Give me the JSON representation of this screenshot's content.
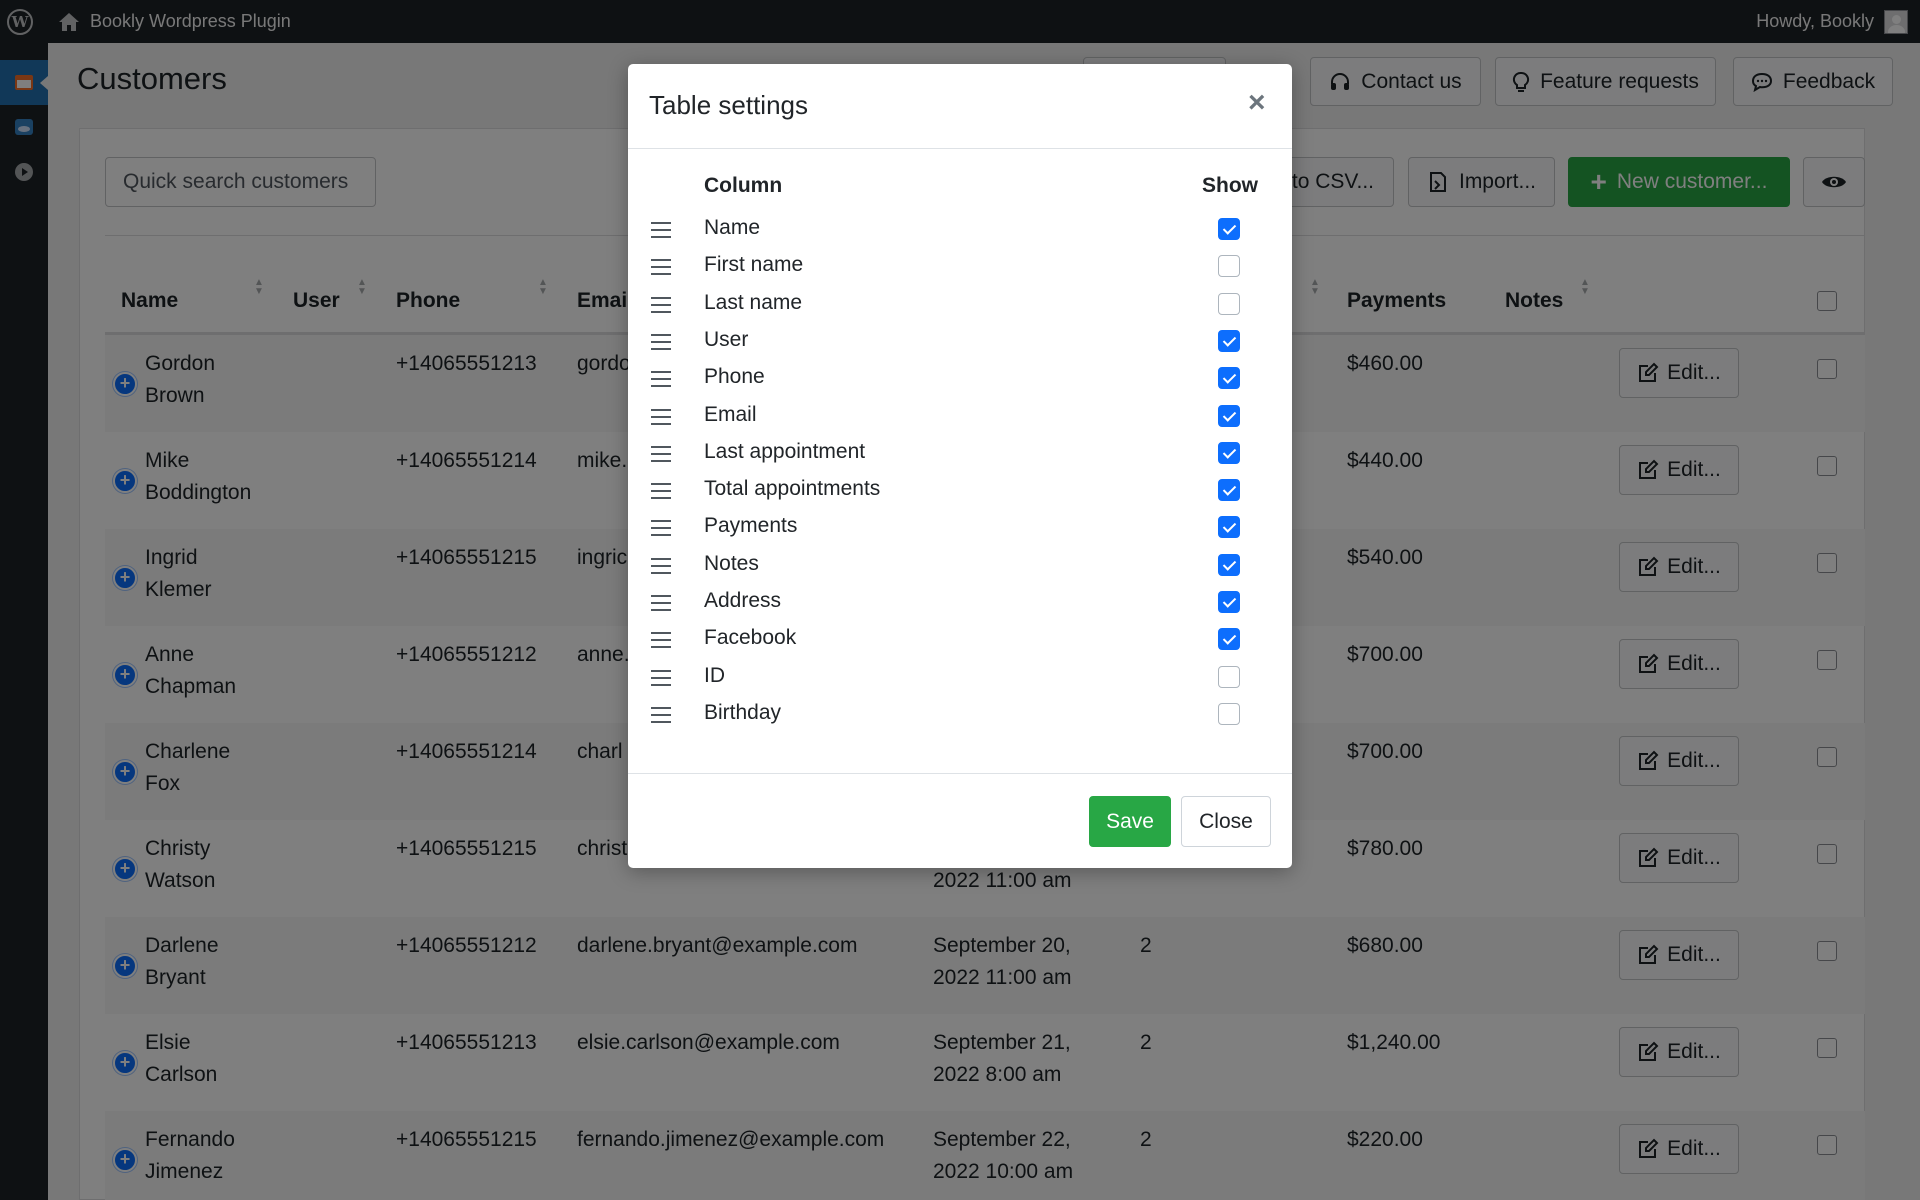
{
  "adminbar": {
    "site_name": "Bookly Wordpress Plugin",
    "howdy": "Howdy, Bookly",
    "wp_logo": "W"
  },
  "page": {
    "title": "Customers"
  },
  "top_buttons": {
    "contact": "Contact us",
    "features": "Feature requests",
    "feedback": "Feedback"
  },
  "toolbar": {
    "search_placeholder": "Quick search customers",
    "export": "to CSV...",
    "import": "Import...",
    "new_customer": "New customer..."
  },
  "table": {
    "columns": [
      "Name",
      "User",
      "Phone",
      "Emai",
      "Payments",
      "Notes"
    ],
    "rows": [
      {
        "first": "Gordon",
        "last": "Brown",
        "phone": "+14065551213",
        "email": "gordo",
        "date1": "",
        "date2": "",
        "total": "",
        "payment": "$460.00",
        "edit": "Edit..."
      },
      {
        "first": "Mike",
        "last": "Boddington",
        "phone": "+14065551214",
        "email": "mike.",
        "date1": "",
        "date2": "",
        "total": "",
        "payment": "$440.00",
        "edit": "Edit..."
      },
      {
        "first": "Ingrid",
        "last": "Klemer",
        "phone": "+14065551215",
        "email": "ingric",
        "date1": "",
        "date2": "",
        "total": "",
        "payment": "$540.00",
        "edit": "Edit..."
      },
      {
        "first": "Anne",
        "last": "Chapman",
        "phone": "+14065551212",
        "email": "anne.",
        "date1": "",
        "date2": "",
        "total": "",
        "payment": "$700.00",
        "edit": "Edit..."
      },
      {
        "first": "Charlene",
        "last": "Fox",
        "phone": "+14065551214",
        "email": "charl",
        "date1": "",
        "date2": "",
        "total": "",
        "payment": "$700.00",
        "edit": "Edit..."
      },
      {
        "first": "Christy",
        "last": "Watson",
        "phone": "+14065551215",
        "email": "christ",
        "date1": "",
        "date2": "2022 11:00 am",
        "total": "",
        "payment": "$780.00",
        "edit": "Edit..."
      },
      {
        "first": "Darlene",
        "last": "Bryant",
        "phone": "+14065551212",
        "email": "darlene.bryant@example.com",
        "date1": "September 20,",
        "date2": "2022 11:00 am",
        "total": "2",
        "payment": "$680.00",
        "edit": "Edit..."
      },
      {
        "first": "Elsie",
        "last": "Carlson",
        "phone": "+14065551213",
        "email": "elsie.carlson@example.com",
        "date1": "September 21,",
        "date2": "2022 8:00 am",
        "total": "2",
        "payment": "$1,240.00",
        "edit": "Edit..."
      },
      {
        "first": "Fernando",
        "last": "Jimenez",
        "phone": "+14065551215",
        "email": "fernando.jimenez@example.com",
        "date1": "September 22,",
        "date2": "2022 10:00 am",
        "total": "2",
        "payment": "$220.00",
        "edit": "Edit..."
      }
    ]
  },
  "modal": {
    "title": "Table settings",
    "close_glyph": "×",
    "column_header": "Column",
    "show_header": "Show",
    "settings": [
      {
        "label": "Name",
        "show": true
      },
      {
        "label": "First name",
        "show": false
      },
      {
        "label": "Last name",
        "show": false
      },
      {
        "label": "User",
        "show": true
      },
      {
        "label": "Phone",
        "show": true
      },
      {
        "label": "Email",
        "show": true
      },
      {
        "label": "Last appointment",
        "show": true
      },
      {
        "label": "Total appointments",
        "show": true
      },
      {
        "label": "Payments",
        "show": true
      },
      {
        "label": "Notes",
        "show": true
      },
      {
        "label": "Address",
        "show": true
      },
      {
        "label": "Facebook",
        "show": true
      },
      {
        "label": "ID",
        "show": false
      },
      {
        "label": "Birthday",
        "show": false
      }
    ],
    "save": "Save",
    "close": "Close"
  },
  "colors": {
    "accent_blue": "#0d6efd",
    "success_green": "#28a745",
    "admin_dark": "#1d2327"
  }
}
